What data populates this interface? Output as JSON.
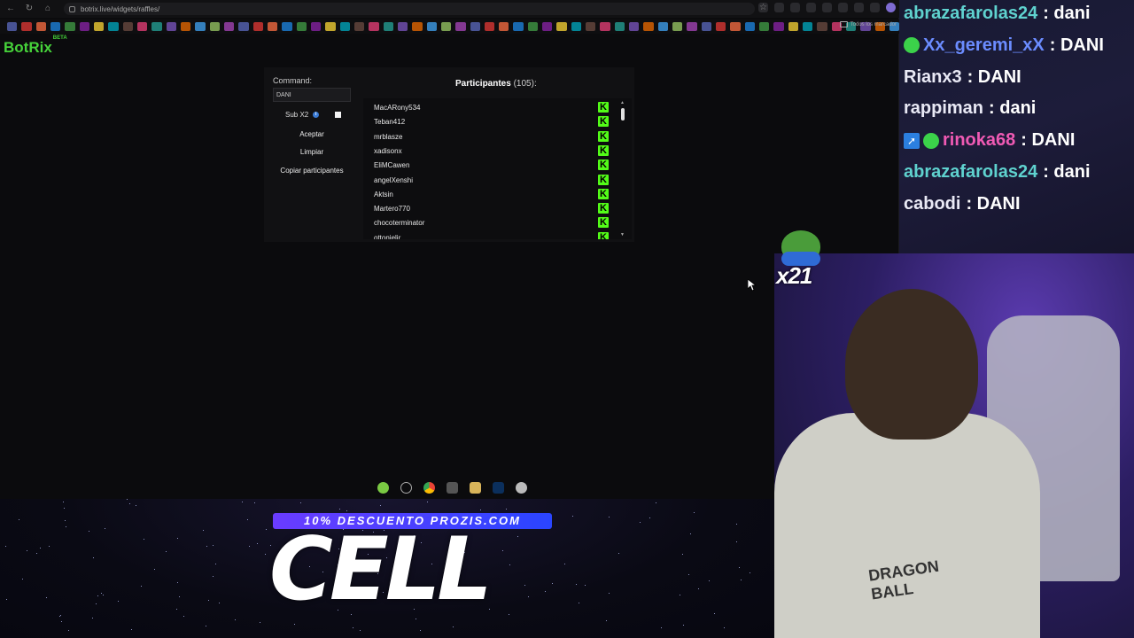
{
  "browser": {
    "url": "botrix.live/widgets/raffles/",
    "bookmarks_all_label": "Todos los marcador"
  },
  "app": {
    "brand": "BotRix",
    "brand_badge": "BETA"
  },
  "raffle": {
    "command_label": "Command:",
    "command_value": "DANI",
    "sub_label": "Sub X2",
    "sub_info_icon": "info-icon",
    "sub_checked": false,
    "accept_label": "Aceptar",
    "clear_label": "Limpiar",
    "copy_label": "Copiar participantes",
    "participants_title": "Participantes",
    "participants_count": "(105):",
    "platform_icon": "kick-icon",
    "participants": [
      "MacARony534",
      "Teban412",
      "mrblasze",
      "xadisonx",
      "EliMCawen",
      "angelXenshi",
      "Aktsin",
      "Martero770",
      "chocoterminator",
      "ottonielir"
    ]
  },
  "chat": {
    "messages": [
      {
        "user": "abrazafarolas24",
        "text": ": dani",
        "color": "#5fd2cf",
        "badges": []
      },
      {
        "user": "Xx_geremi_xX",
        "text": ": DANI",
        "color": "#6b8cff",
        "badges": [
          "sub-badge"
        ]
      },
      {
        "user": "Rianx3",
        "text": ": DANI",
        "color": "#e9e9f5",
        "badges": []
      },
      {
        "user": "rappiman",
        "text": ": dani",
        "color": "#e9e9f5",
        "badges": []
      },
      {
        "user": "rinoka68",
        "text": ": DANI",
        "color": "#f05ab4",
        "badges": [
          "vip-badge",
          "sub-badge"
        ]
      },
      {
        "user": "abrazafarolas24",
        "text": ": dani",
        "color": "#5fd2cf",
        "badges": []
      },
      {
        "user": "cabodi",
        "text": ": DANI",
        "color": "#e9e9f5",
        "badges": []
      }
    ]
  },
  "overlay": {
    "emote_count": "x21",
    "promo_banner": "10% DESCUENTO PROZIS.COM",
    "promo_code": "CELL",
    "hoodie_print": "DRAGON BALL"
  }
}
